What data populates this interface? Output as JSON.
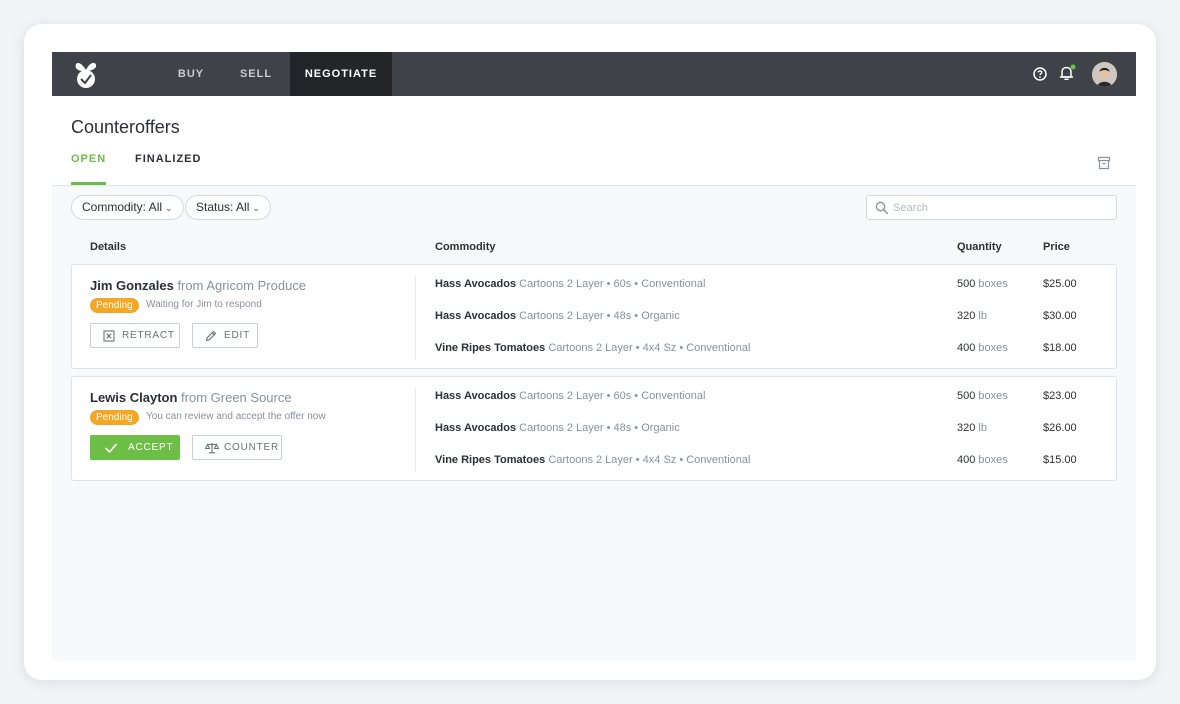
{
  "nav": {
    "items": [
      "BUY",
      "SELL",
      "NEGOTIATE"
    ],
    "active": "NEGOTIATE",
    "notification_dot_color": "#6cbf44"
  },
  "page": {
    "title": "Counteroffers",
    "tabs": [
      "OPEN",
      "FINALIZED"
    ],
    "active_tab": "OPEN"
  },
  "filters": {
    "commodity": "Commodity: All",
    "status": "Status: All",
    "search_placeholder": "Search"
  },
  "columns": {
    "details": "Details",
    "commodity": "Commodity",
    "quantity": "Quantity",
    "price": "Price"
  },
  "offers": [
    {
      "name": "Jim Gonzales",
      "from": "from Agricom Produce",
      "status": "Pending",
      "note": "Waiting for Jim to respond",
      "actions": [
        "RETRACT",
        "EDIT"
      ],
      "items": [
        {
          "commodity": "Hass Avocados",
          "desc": "Cartoons 2 Layer • 60s • Conventional",
          "qty": "500",
          "unit": "boxes",
          "price": "$25.00"
        },
        {
          "commodity": "Hass Avocados",
          "desc": "Cartoons 2 Layer • 48s • Organic",
          "qty": "320",
          "unit": "lb",
          "price": "$30.00"
        },
        {
          "commodity": "Vine Ripes Tomatoes",
          "desc": "Cartoons 2 Layer • 4x4 Sz • Conventional",
          "qty": "400",
          "unit": "boxes",
          "price": "$18.00"
        }
      ]
    },
    {
      "name": "Lewis Clayton",
      "from": "from Green Source",
      "status": "Pending",
      "note": "You can review and accept the offer now",
      "actions": [
        "ACCEPT",
        "COUNTER"
      ],
      "items": [
        {
          "commodity": "Hass Avocados",
          "desc": "Cartoons 2 Layer • 60s • Conventional",
          "qty": "500",
          "unit": "boxes",
          "price": "$23.00"
        },
        {
          "commodity": "Hass Avocados",
          "desc": "Cartoons 2 Layer • 48s • Organic",
          "qty": "320",
          "unit": "lb",
          "price": "$26.00"
        },
        {
          "commodity": "Vine Ripes Tomatoes",
          "desc": "Cartoons 2 Layer • 4x4 Sz • Conventional",
          "qty": "400",
          "unit": "boxes",
          "price": "$15.00"
        }
      ]
    }
  ],
  "colors": {
    "accent": "#6cbf44",
    "pending": "#f5a623",
    "topbar": "#3f4349"
  }
}
